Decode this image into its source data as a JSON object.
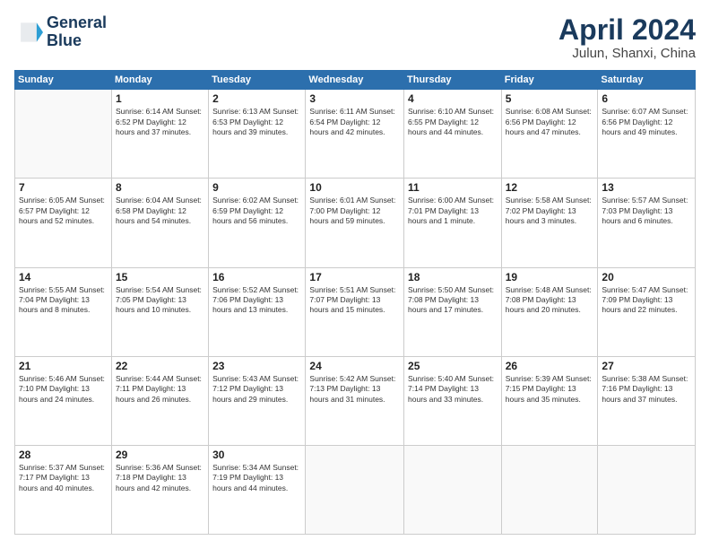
{
  "header": {
    "logo_line1": "General",
    "logo_line2": "Blue",
    "month": "April 2024",
    "location": "Julun, Shanxi, China"
  },
  "days_of_week": [
    "Sunday",
    "Monday",
    "Tuesday",
    "Wednesday",
    "Thursday",
    "Friday",
    "Saturday"
  ],
  "weeks": [
    [
      {
        "day": "",
        "detail": ""
      },
      {
        "day": "1",
        "detail": "Sunrise: 6:14 AM\nSunset: 6:52 PM\nDaylight: 12 hours\nand 37 minutes."
      },
      {
        "day": "2",
        "detail": "Sunrise: 6:13 AM\nSunset: 6:53 PM\nDaylight: 12 hours\nand 39 minutes."
      },
      {
        "day": "3",
        "detail": "Sunrise: 6:11 AM\nSunset: 6:54 PM\nDaylight: 12 hours\nand 42 minutes."
      },
      {
        "day": "4",
        "detail": "Sunrise: 6:10 AM\nSunset: 6:55 PM\nDaylight: 12 hours\nand 44 minutes."
      },
      {
        "day": "5",
        "detail": "Sunrise: 6:08 AM\nSunset: 6:56 PM\nDaylight: 12 hours\nand 47 minutes."
      },
      {
        "day": "6",
        "detail": "Sunrise: 6:07 AM\nSunset: 6:56 PM\nDaylight: 12 hours\nand 49 minutes."
      }
    ],
    [
      {
        "day": "7",
        "detail": "Sunrise: 6:05 AM\nSunset: 6:57 PM\nDaylight: 12 hours\nand 52 minutes."
      },
      {
        "day": "8",
        "detail": "Sunrise: 6:04 AM\nSunset: 6:58 PM\nDaylight: 12 hours\nand 54 minutes."
      },
      {
        "day": "9",
        "detail": "Sunrise: 6:02 AM\nSunset: 6:59 PM\nDaylight: 12 hours\nand 56 minutes."
      },
      {
        "day": "10",
        "detail": "Sunrise: 6:01 AM\nSunset: 7:00 PM\nDaylight: 12 hours\nand 59 minutes."
      },
      {
        "day": "11",
        "detail": "Sunrise: 6:00 AM\nSunset: 7:01 PM\nDaylight: 13 hours\nand 1 minute."
      },
      {
        "day": "12",
        "detail": "Sunrise: 5:58 AM\nSunset: 7:02 PM\nDaylight: 13 hours\nand 3 minutes."
      },
      {
        "day": "13",
        "detail": "Sunrise: 5:57 AM\nSunset: 7:03 PM\nDaylight: 13 hours\nand 6 minutes."
      }
    ],
    [
      {
        "day": "14",
        "detail": "Sunrise: 5:55 AM\nSunset: 7:04 PM\nDaylight: 13 hours\nand 8 minutes."
      },
      {
        "day": "15",
        "detail": "Sunrise: 5:54 AM\nSunset: 7:05 PM\nDaylight: 13 hours\nand 10 minutes."
      },
      {
        "day": "16",
        "detail": "Sunrise: 5:52 AM\nSunset: 7:06 PM\nDaylight: 13 hours\nand 13 minutes."
      },
      {
        "day": "17",
        "detail": "Sunrise: 5:51 AM\nSunset: 7:07 PM\nDaylight: 13 hours\nand 15 minutes."
      },
      {
        "day": "18",
        "detail": "Sunrise: 5:50 AM\nSunset: 7:08 PM\nDaylight: 13 hours\nand 17 minutes."
      },
      {
        "day": "19",
        "detail": "Sunrise: 5:48 AM\nSunset: 7:08 PM\nDaylight: 13 hours\nand 20 minutes."
      },
      {
        "day": "20",
        "detail": "Sunrise: 5:47 AM\nSunset: 7:09 PM\nDaylight: 13 hours\nand 22 minutes."
      }
    ],
    [
      {
        "day": "21",
        "detail": "Sunrise: 5:46 AM\nSunset: 7:10 PM\nDaylight: 13 hours\nand 24 minutes."
      },
      {
        "day": "22",
        "detail": "Sunrise: 5:44 AM\nSunset: 7:11 PM\nDaylight: 13 hours\nand 26 minutes."
      },
      {
        "day": "23",
        "detail": "Sunrise: 5:43 AM\nSunset: 7:12 PM\nDaylight: 13 hours\nand 29 minutes."
      },
      {
        "day": "24",
        "detail": "Sunrise: 5:42 AM\nSunset: 7:13 PM\nDaylight: 13 hours\nand 31 minutes."
      },
      {
        "day": "25",
        "detail": "Sunrise: 5:40 AM\nSunset: 7:14 PM\nDaylight: 13 hours\nand 33 minutes."
      },
      {
        "day": "26",
        "detail": "Sunrise: 5:39 AM\nSunset: 7:15 PM\nDaylight: 13 hours\nand 35 minutes."
      },
      {
        "day": "27",
        "detail": "Sunrise: 5:38 AM\nSunset: 7:16 PM\nDaylight: 13 hours\nand 37 minutes."
      }
    ],
    [
      {
        "day": "28",
        "detail": "Sunrise: 5:37 AM\nSunset: 7:17 PM\nDaylight: 13 hours\nand 40 minutes."
      },
      {
        "day": "29",
        "detail": "Sunrise: 5:36 AM\nSunset: 7:18 PM\nDaylight: 13 hours\nand 42 minutes."
      },
      {
        "day": "30",
        "detail": "Sunrise: 5:34 AM\nSunset: 7:19 PM\nDaylight: 13 hours\nand 44 minutes."
      },
      {
        "day": "",
        "detail": ""
      },
      {
        "day": "",
        "detail": ""
      },
      {
        "day": "",
        "detail": ""
      },
      {
        "day": "",
        "detail": ""
      }
    ]
  ]
}
